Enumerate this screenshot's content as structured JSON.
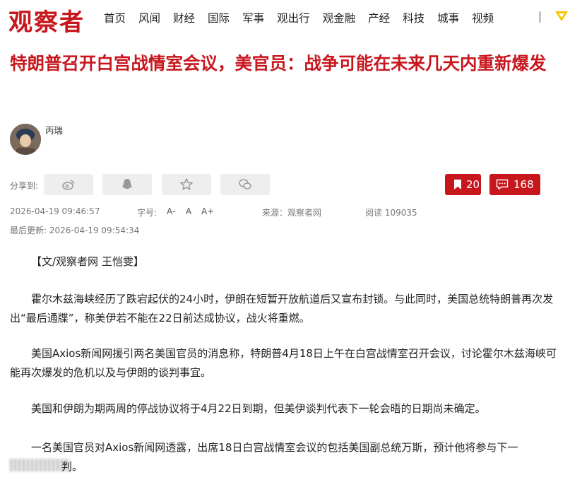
{
  "site": {
    "logo": "观察者"
  },
  "nav": {
    "items": [
      "首页",
      "风闻",
      "财经",
      "国际",
      "军事",
      "观出行",
      "观金融",
      "产经",
      "科技",
      "城事",
      "视频"
    ],
    "separator": "|"
  },
  "article": {
    "title": "特朗普召开白宫战情室会议，美官员：战争可能在未来几天内重新爆发",
    "author": "丙瑞",
    "share_label": "分享到:",
    "bookmark_count": "20",
    "comment_count": "168",
    "published": "2026-04-19 09:46:57",
    "font_size_label": "字号:",
    "font_options": [
      "A-",
      "A",
      "A+"
    ],
    "source": "来源：观察者网",
    "reads": "阅读 109035",
    "updated": "最后更新: 2026-04-19 09:54:34",
    "byline": "【文/观察者网 王恺雯】",
    "paragraphs": [
      "霍尔木兹海峡经历了跌宕起伏的24小时，伊朗在短暂开放航道后又宣布封锁。与此同时，美国总统特朗普再次发出“最后通牒”，称美伊若不能在22日前达成协议，战火将重燃。",
      "美国Axios新闻网援引两名美国官员的消息称，特朗普4月18日上午在白宫战情室召开会议，讨论霍尔木兹海峡可能再次爆发的危机以及与伊朗的谈判事宜。",
      "美国和伊朗为期两周的停战协议将于4月22日到期，但美伊谈判代表下一轮会晤的日期尚未确定。",
      "一名美国官员对Axios新闻网透露，出席18日白宫战情室会议的包括美国副总统万斯，预计他将参与下一"
    ],
    "trailing_fragment": "判。"
  },
  "colors": {
    "brand": "#c8161d",
    "button_gray": "#eeeeee"
  },
  "icons": {
    "share": [
      "weibo-icon",
      "qq-icon",
      "star-icon",
      "wechat-icon"
    ],
    "bookmark": "bookmark-icon",
    "comment": "comment-icon",
    "vip": "vip-icon"
  }
}
